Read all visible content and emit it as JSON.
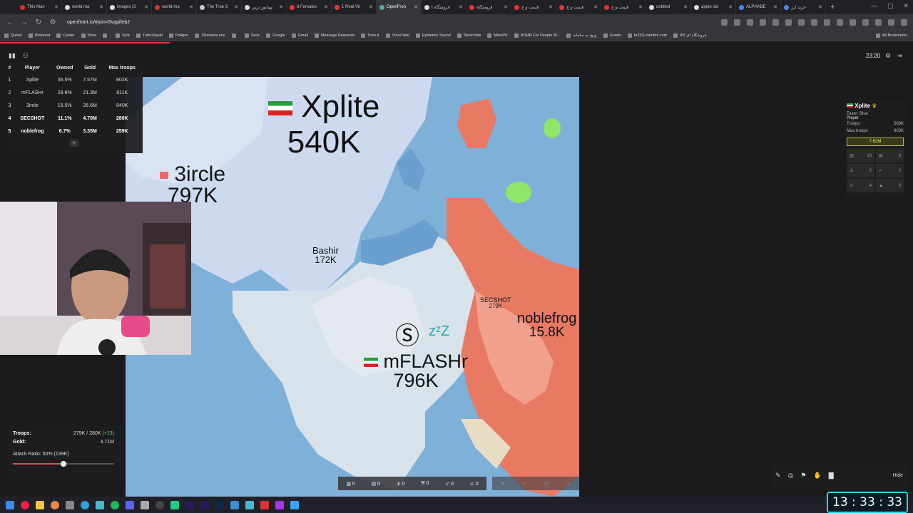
{
  "browser": {
    "tabs": [
      {
        "label": "This Man",
        "color": "#d33"
      },
      {
        "label": "world ma",
        "color": "#ddd"
      },
      {
        "label": "images (3",
        "color": "#ddd"
      },
      {
        "label": "world-ma",
        "color": "#d33"
      },
      {
        "label": "The True S",
        "color": "#ccc"
      },
      {
        "label": "پهنانور ترین",
        "color": "#ddd"
      },
      {
        "label": "8 Females",
        "color": "#e33"
      },
      {
        "label": "1 Real Vir",
        "color": "#e33"
      },
      {
        "label": "OpenFron",
        "color": "#5aa"
      },
      {
        "label": "فروشگاه ا",
        "color": "#ddd"
      },
      {
        "label": "فروشگاه",
        "color": "#e33"
      },
      {
        "label": "قیمت و خ",
        "color": "#e33"
      },
      {
        "label": "قیمت و خ",
        "color": "#e33"
      },
      {
        "label": "قیمت و خ",
        "color": "#e33"
      },
      {
        "label": "untitled",
        "color": "#ddd"
      },
      {
        "label": "apple sto",
        "color": "#ddd"
      },
      {
        "label": "ALPHABE",
        "color": "#48f"
      },
      {
        "label": "خرید ارز",
        "color": "#48f"
      }
    ],
    "url": "openfront.io/#join=5vqpifebJ",
    "bookmarks": [
      "Quixel",
      "Pinterest",
      "Cooler",
      "Drive",
      "",
      "Kick",
      "TurboSquid",
      "Poligon",
      "3Dassets.one",
      "",
      "Grok",
      "Google",
      "Gmail",
      "Message Requests",
      "Time.ir",
      "VirusTotal",
      "Epidemic Sound",
      "Sketchfab",
      "MinePic",
      "ASMR For People W...",
      "ورود به سامانه",
      "Goods",
      "In23G.irandmi.com",
      "فروشگاه ای کالا"
    ],
    "all_bookmarks": "All Bookmarks"
  },
  "leaderboard": {
    "headers": [
      "#",
      "Player",
      "Owned",
      "Gold",
      "Max troops"
    ],
    "rows": [
      {
        "rank": "1",
        "player": "Xplite",
        "owned": "35.5%",
        "gold": "7.57M",
        "max": "802K"
      },
      {
        "rank": "2",
        "player": "mFLASHr",
        "owned": "28.6%",
        "gold": "21.3M",
        "max": "811K"
      },
      {
        "rank": "3",
        "player": "3ircle",
        "owned": "15.5%",
        "gold": "26.6M",
        "max": "840K"
      },
      {
        "rank": "4",
        "player": "SECSHOT",
        "owned": "11.1%",
        "gold": "4.70M",
        "max": "280K"
      },
      {
        "rank": "5",
        "player": "noblefrog",
        "owned": "6.7%",
        "gold": "3.35M",
        "max": "259K"
      }
    ],
    "more_label": "+"
  },
  "map_labels": {
    "xplite": {
      "name": "Xplite",
      "troops": "540K"
    },
    "circle": {
      "name": "3ircle",
      "troops": "797K"
    },
    "bashir": {
      "name": "Bashir",
      "troops": "172K"
    },
    "secshot": {
      "name": "SECSHOT",
      "troops": "279K"
    },
    "noblefrog": {
      "name": "noblefrog",
      "troops": "15.8K"
    },
    "mflashr": {
      "name": "mFLASHr",
      "troops": "796K"
    }
  },
  "status": {
    "troops_label": "Troops:",
    "troops_value": "279K / 280K",
    "troops_delta": "(+13)",
    "gold_label": "Gold:",
    "gold_value": "4.71M",
    "attack_ratio": "Attack Ratio: 50% (139K)",
    "attack_ratio_fraction": 0.5
  },
  "top_right": {
    "time": "23:20"
  },
  "player_info": {
    "name": "Xplite",
    "team": "Team: Blue",
    "type": "Player",
    "troops_label": "Troops",
    "troops": "568K",
    "max_troops_label": "Max troops",
    "max_troops": "803K",
    "gold": "7.62M",
    "stats": [
      "10",
      "8",
      "2",
      "2",
      "4",
      "0"
    ]
  },
  "build_bar": {
    "counts": [
      "0",
      "0",
      "0",
      "0",
      "0",
      "0"
    ]
  },
  "tools": {
    "hide": "Hide"
  },
  "taskbar_clock": "13 : 33 : 33"
}
